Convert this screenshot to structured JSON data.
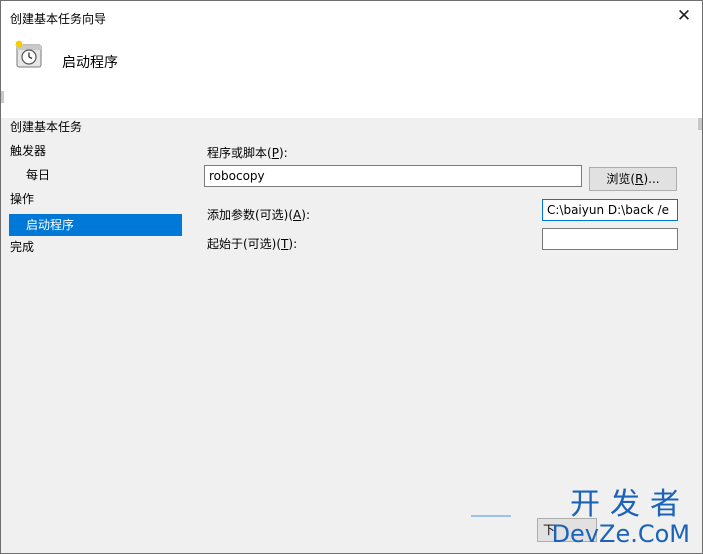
{
  "window": {
    "title": "创建基本任务向导",
    "close_glyph": "✕"
  },
  "header": {
    "icon": "task-scheduler-clock-icon",
    "title": "启动程序"
  },
  "nav": {
    "items": [
      {
        "label": "创建基本任务",
        "selected": false
      },
      {
        "label": "触发器",
        "selected": false
      },
      {
        "label": "每日",
        "selected": false
      },
      {
        "label": "操作",
        "selected": false
      },
      {
        "label": "启动程序",
        "selected": true
      },
      {
        "label": "完成",
        "selected": false
      }
    ]
  },
  "form": {
    "program_label_text": "程序或脚本(",
    "program_label_key": "P",
    "program_label_end": "):",
    "program_value": "robocopy",
    "browse_text": "浏览(",
    "browse_key": "R",
    "browse_end": ")...",
    "args_label_text": "添加参数(可选)(",
    "args_label_key": "A",
    "args_label_end": "):",
    "args_value": "C:\\baiyun D:\\back /e",
    "start_label_text": "起始于(可选)(",
    "start_label_key": "T",
    "start_label_end": "):",
    "start_value": ""
  },
  "footer": {
    "next_partial": "下"
  },
  "watermark": {
    "cn": "开发者",
    "en": "DevZe.CoM"
  },
  "colors": {
    "accent": "#0078d7",
    "watermark": "#1a63b8"
  }
}
